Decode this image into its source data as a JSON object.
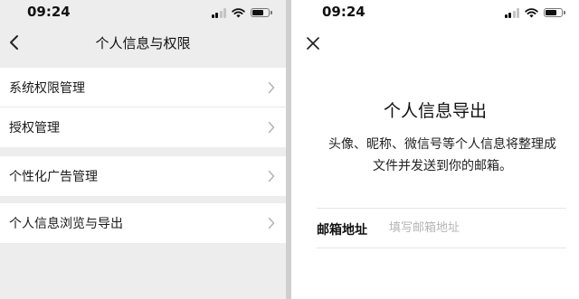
{
  "left_screen": {
    "status_bar": {
      "time": "09:24"
    },
    "nav": {
      "title": "个人信息与权限",
      "back_icon": "chevron-left-icon"
    },
    "groups": [
      {
        "items": [
          {
            "label": "系统权限管理"
          },
          {
            "label": "授权管理"
          }
        ]
      },
      {
        "items": [
          {
            "label": "个性化广告管理"
          }
        ]
      },
      {
        "items": [
          {
            "label": "个人信息浏览与导出"
          }
        ]
      }
    ],
    "row_chevron_icon": "chevron-right-icon"
  },
  "right_screen": {
    "status_bar": {
      "time": "09:24"
    },
    "close_icon": "close-icon",
    "title": "个人信息导出",
    "description_line1": "头像、昵称、微信号等个人信息将整理成",
    "description_line2": "文件并发送到你的邮箱。",
    "email_field": {
      "label": "邮箱地址",
      "placeholder": "填写邮箱地址",
      "value": ""
    }
  },
  "colors": {
    "page_bg": "#ededed",
    "panel_bg": "#ffffff",
    "divider": "#cfcfcf",
    "placeholder": "#b5b5b5"
  }
}
